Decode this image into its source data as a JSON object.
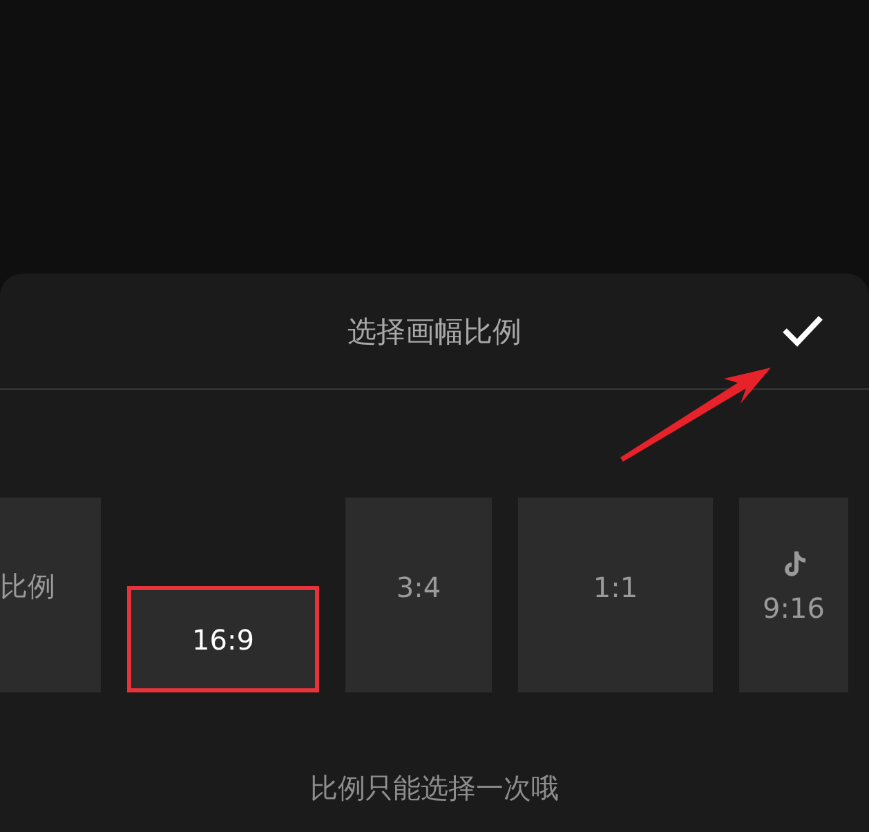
{
  "sheet": {
    "title": "选择画幅比例",
    "hint": "比例只能选择一次哦"
  },
  "ratios": [
    {
      "label": "比例",
      "kind": "plain",
      "selected": false
    },
    {
      "label": "16:9",
      "kind": "plain",
      "selected": true
    },
    {
      "label": "3:4",
      "kind": "plain",
      "selected": false
    },
    {
      "label": "1:1",
      "kind": "plain",
      "selected": false
    },
    {
      "label": "9:16",
      "kind": "tiktok",
      "selected": false
    }
  ]
}
